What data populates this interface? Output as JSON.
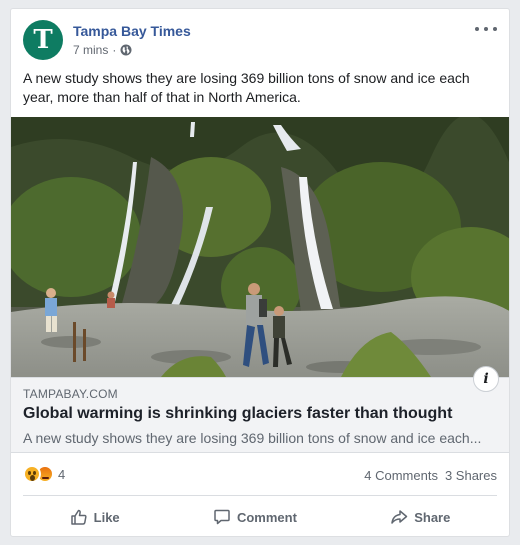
{
  "post": {
    "page_name": "Tampa Bay Times",
    "avatar_letter": "T",
    "timestamp": "7 mins",
    "meta_separator": "·",
    "privacy_icon": "globe-icon",
    "text": "A new study shows they are losing 369 billion tons of snow and ice each year, more than half of that in North America."
  },
  "link": {
    "domain": "TAMPABAY.COM",
    "headline": "Global warming is shrinking glaciers faster than thought",
    "description": "A new study shows they are losing 369 billion tons of snow and ice each...",
    "info_glyph": "i"
  },
  "engagement": {
    "reaction_icons": [
      "wow-reaction-icon",
      "angry-reaction-icon"
    ],
    "reaction_count": "4",
    "comments": "4 Comments",
    "shares": "3 Shares"
  },
  "actions": {
    "like": "Like",
    "comment": "Comment",
    "share": "Share"
  },
  "colors": {
    "brand_link": "#365899",
    "avatar_bg": "#0e7c62",
    "muted_text": "#606770"
  }
}
